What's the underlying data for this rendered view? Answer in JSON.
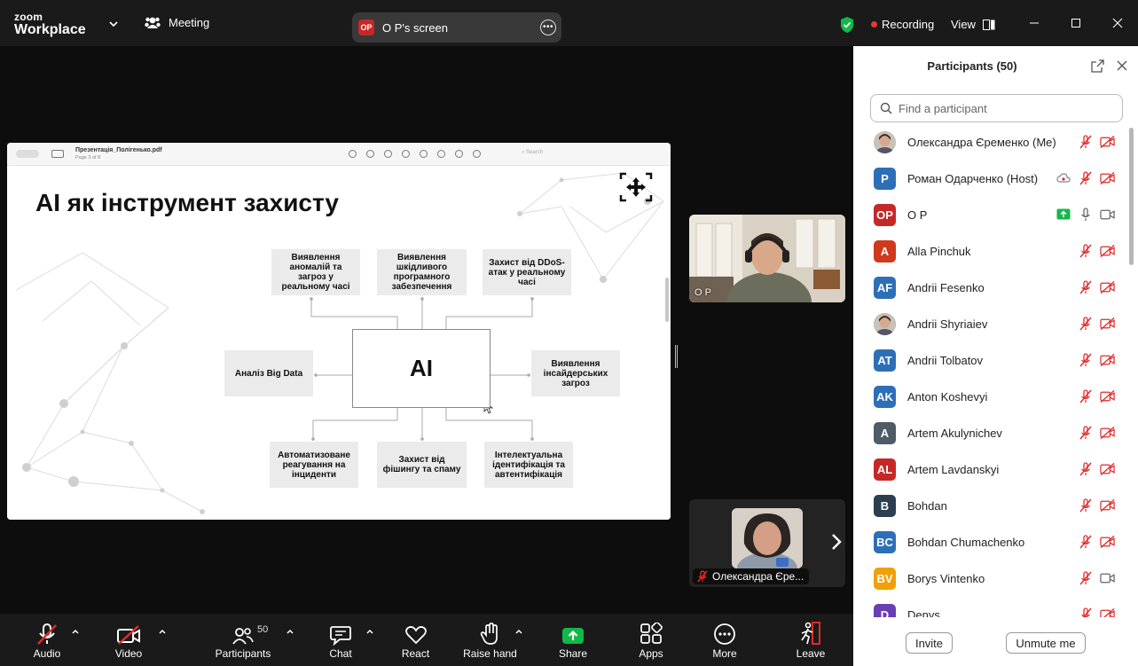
{
  "app": {
    "logo_line1": "zoom",
    "logo_line2": "Workplace",
    "meeting_label": "Meeting",
    "screen_share_label": "O P's screen",
    "screen_share_avatar": "OP",
    "recording_label": "Recording",
    "view_label": "View"
  },
  "pdf": {
    "filename": "Презентація_Полігенько.pdf",
    "page_info": "Page 3 of 8",
    "search_placeholder": "Search"
  },
  "slide": {
    "title": "AI як інструмент захисту",
    "center": "AI",
    "boxes": {
      "anomalies": "Виявлення аномалій та загроз у реальному часі",
      "malware": "Виявлення шкідливого програмного забезпечення",
      "ddos": "Захист від DDoS-атак у реальному часі",
      "bigdata": "Аналіз Big Data",
      "insider": "Виявлення інсайдерських загроз",
      "automation": "Автоматизоване реагування на інциденти",
      "phishing": "Захист від фішингу та спаму",
      "auth": "Інтелектуальна ідентифікація та автентифікація"
    }
  },
  "video": {
    "speaker_name": "O P",
    "self_name": "Олександра Єре..."
  },
  "participants": {
    "title": "Participants (50)",
    "search_placeholder": "Find a participant",
    "invite_label": "Invite",
    "unmute_label": "Unmute me",
    "list": [
      {
        "name": "Олександра Єременко (Me)",
        "avatar": "",
        "color": "#b08a6e",
        "photo": true,
        "audio": "muted",
        "video": "off"
      },
      {
        "name": "Роман Одарченко (Host)",
        "avatar": "P",
        "color": "#2d6fb7",
        "audio": "muted",
        "video": "off",
        "cloud": true
      },
      {
        "name": "O P",
        "avatar": "OP",
        "color": "#c62828",
        "audio": "on",
        "video": "on",
        "share": true
      },
      {
        "name": "Alla Pinchuk",
        "avatar": "A",
        "color": "#d0391c",
        "audio": "muted",
        "video": "off"
      },
      {
        "name": "Andrii Fesenko",
        "avatar": "AF",
        "color": "#2d6fb7",
        "audio": "muted",
        "video": "off"
      },
      {
        "name": "Andrii Shyriaiev",
        "avatar": "",
        "color": "#6b7a8f",
        "photo": true,
        "audio": "muted",
        "video": "off"
      },
      {
        "name": "Andrii Tolbatov",
        "avatar": "AT",
        "color": "#2d6fb7",
        "audio": "muted",
        "video": "off"
      },
      {
        "name": "Anton Koshevyi",
        "avatar": "AK",
        "color": "#2d6fb7",
        "audio": "muted",
        "video": "off"
      },
      {
        "name": "Artem Akulynichev",
        "avatar": "A",
        "color": "#4f5b66",
        "audio": "muted",
        "video": "off"
      },
      {
        "name": "Artem Lavdanskyi",
        "avatar": "AL",
        "color": "#c62828",
        "audio": "muted",
        "video": "off"
      },
      {
        "name": "Bohdan",
        "avatar": "B",
        "color": "#2c3e50",
        "audio": "muted",
        "video": "off"
      },
      {
        "name": "Bohdan Chumachenko",
        "avatar": "BC",
        "color": "#2d6fb7",
        "audio": "muted",
        "video": "off"
      },
      {
        "name": "Borys Vintenko",
        "avatar": "BV",
        "color": "#f2a007",
        "audio": "muted",
        "video": "on"
      },
      {
        "name": "Denys",
        "avatar": "D",
        "color": "#6a3fb5",
        "audio": "muted",
        "video": "off"
      }
    ]
  },
  "toolbar": {
    "audio": "Audio",
    "video": "Video",
    "participants": "Participants",
    "participants_count": "50",
    "chat": "Chat",
    "react": "React",
    "raise_hand": "Raise hand",
    "share": "Share",
    "apps": "Apps",
    "more": "More",
    "leave": "Leave"
  },
  "colors": {
    "accent_green": "#12b84a",
    "muted_red": "#e02b2b",
    "recording_red": "#e53935"
  }
}
